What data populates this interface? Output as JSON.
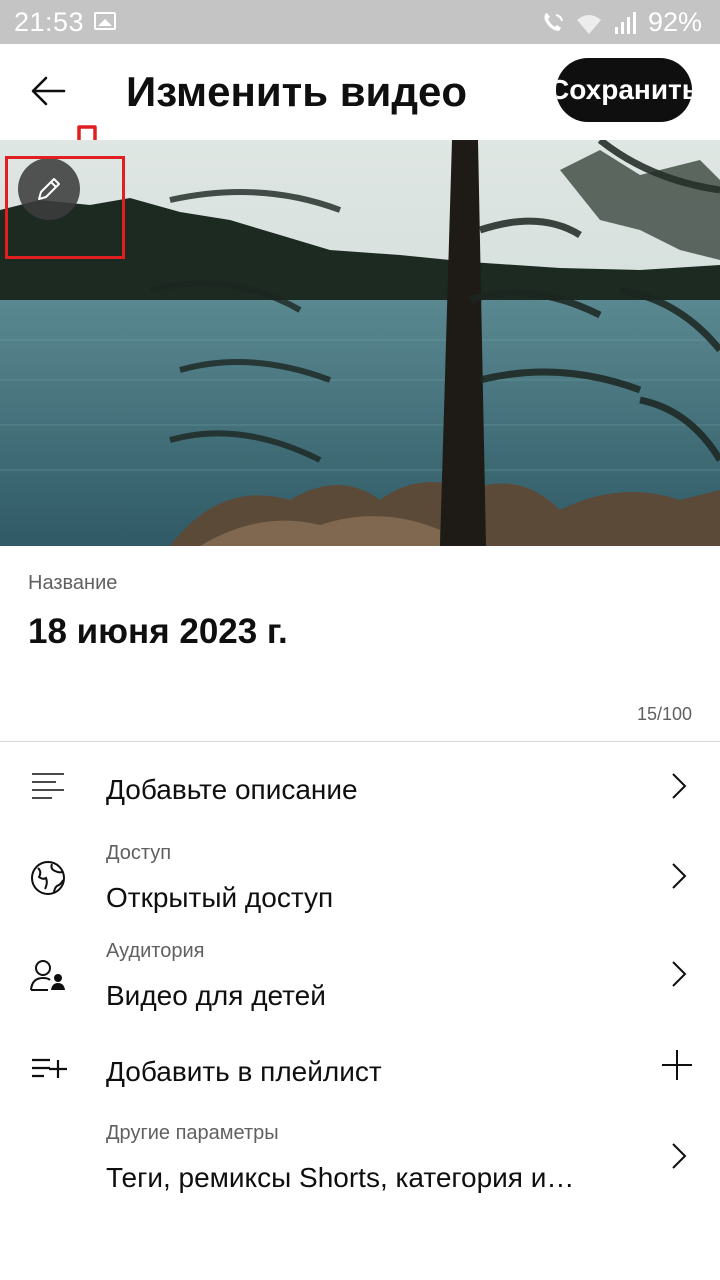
{
  "status_bar": {
    "time": "21:53",
    "battery": "92%"
  },
  "header": {
    "back_icon": "arrow-left-icon",
    "title": "Изменить видео",
    "save_label": "Сохранить"
  },
  "thumbnail": {
    "edit_icon": "pencil-icon"
  },
  "title_field": {
    "label": "Название",
    "value": "18 июня 2023 г.",
    "counter": "15/100"
  },
  "menu": {
    "description": {
      "label": "Добавьте описание",
      "icon": "description-lines-icon"
    },
    "access": {
      "sub": "Доступ",
      "label": "Открытый доступ",
      "icon": "globe-icon"
    },
    "audience": {
      "sub": "Аудитория",
      "label": "Видео для детей",
      "icon": "audience-icon"
    },
    "playlist": {
      "label": "Добавить в плейлист",
      "icon": "playlist-add-icon"
    },
    "more": {
      "sub": "Другие параметры",
      "label": "Теги, ремиксы Shorts, категория и…"
    }
  },
  "colors": {
    "annotation": "#e02020",
    "accent": "#0f0f0f",
    "status_bar": "#c4c4c4"
  }
}
